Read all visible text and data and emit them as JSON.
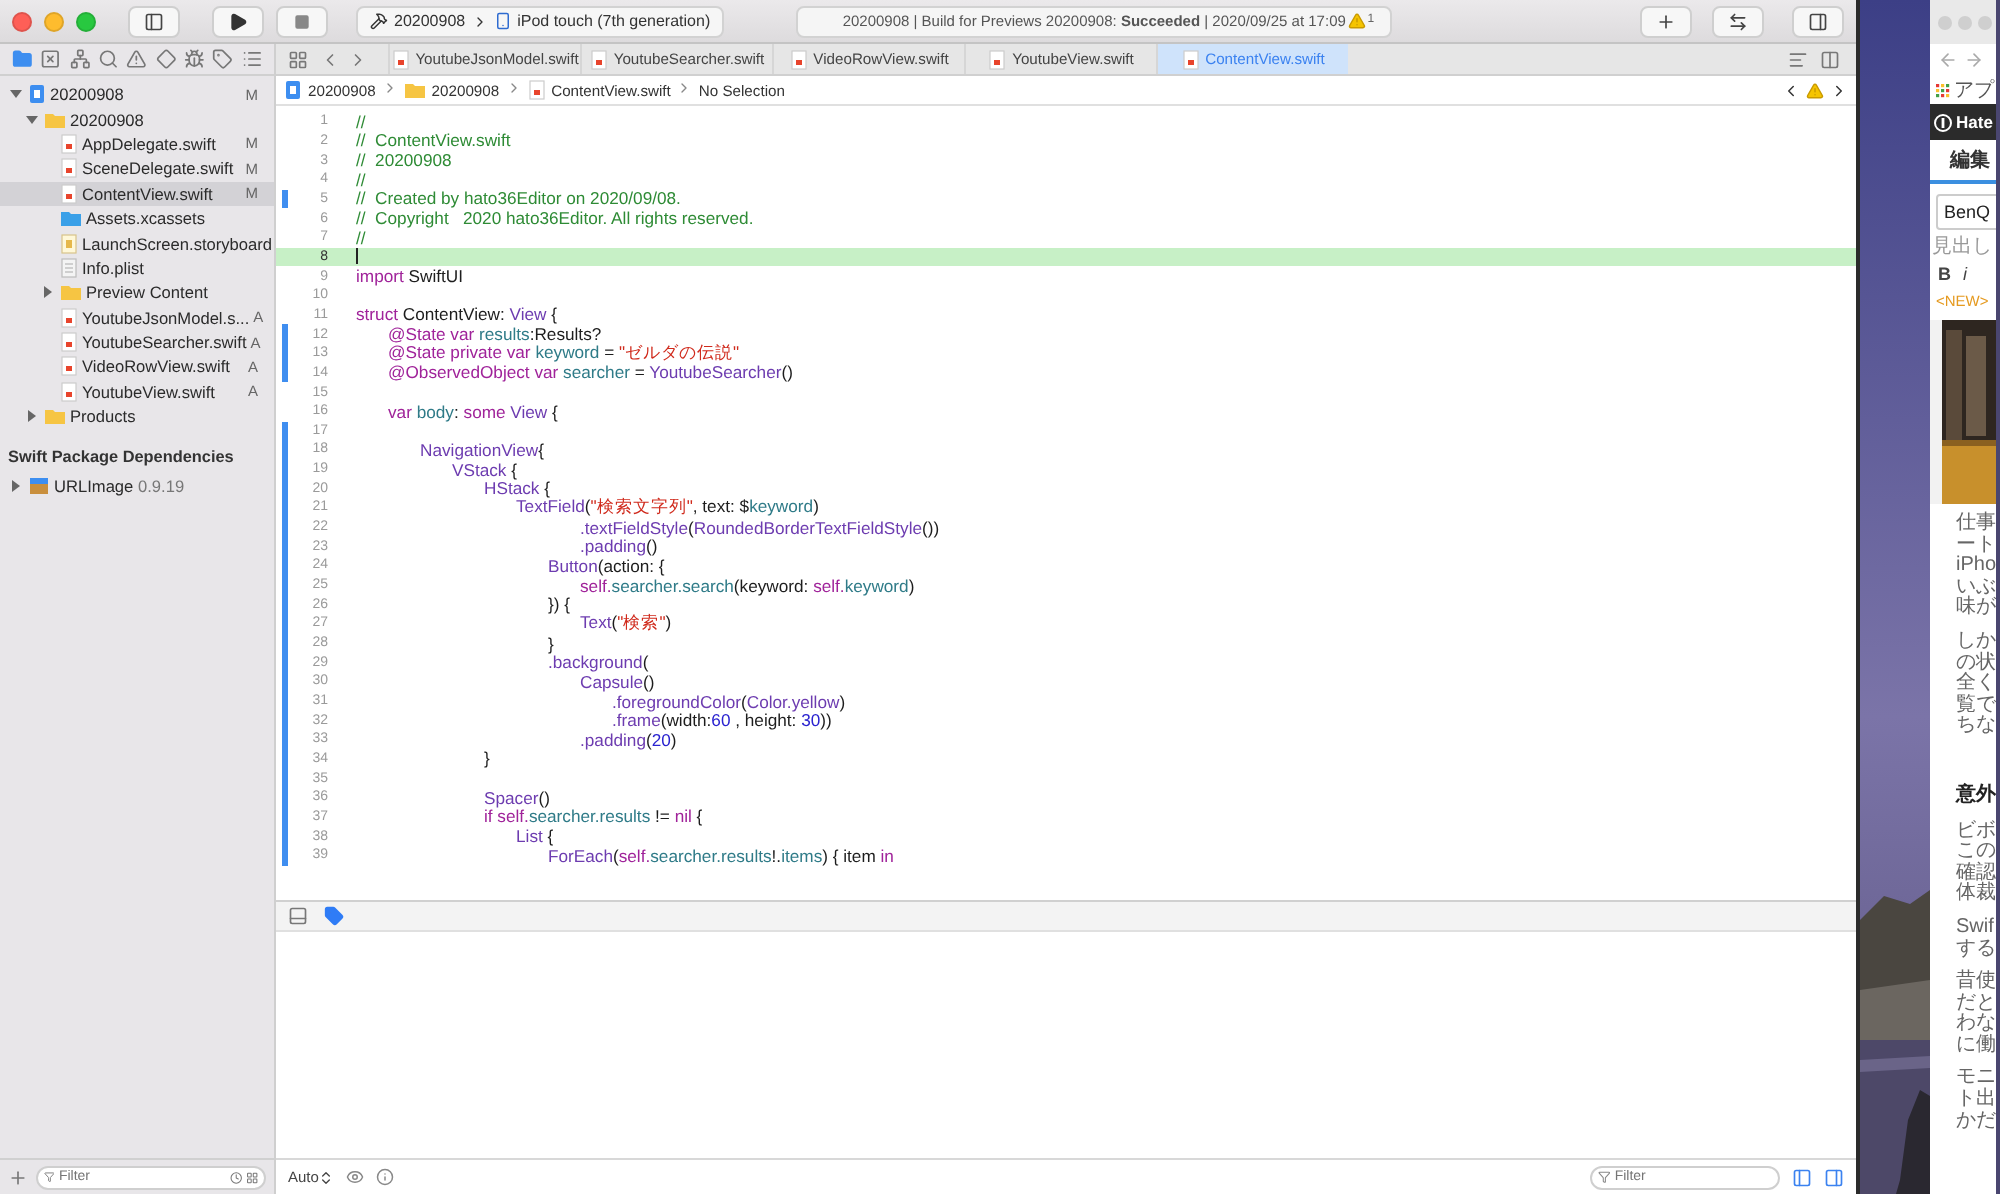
{
  "toolbar": {
    "scheme": {
      "project": "20200908",
      "device": "iPod touch (7th generation)"
    },
    "activity": {
      "text": "20200908 | Build for Previews 20200908: **Succeeded** | 2020/09/25 at 17:09",
      "warnings": "1"
    }
  },
  "navigator": {
    "tree": [
      {
        "name": "20200908",
        "kind": "project",
        "badge": "M",
        "expanded": true,
        "selected": false,
        "children": [
          {
            "name": "20200908",
            "kind": "folder",
            "expanded": true,
            "selected": false,
            "children": [
              {
                "name": "AppDelegate.swift",
                "kind": "swift",
                "badge": "M",
                "selected": false
              },
              {
                "name": "SceneDelegate.swift",
                "kind": "swift",
                "badge": "M",
                "selected": false
              },
              {
                "name": "ContentView.swift",
                "kind": "swift",
                "badge": "M",
                "selected": true
              },
              {
                "name": "Assets.xcassets",
                "kind": "assets",
                "selected": false
              },
              {
                "name": "LaunchScreen.storyboard",
                "kind": "storyboard",
                "selected": false
              },
              {
                "name": "Info.plist",
                "kind": "plist",
                "selected": false
              },
              {
                "name": "Preview Content",
                "kind": "folder",
                "expanded": false,
                "selected": false
              },
              {
                "name": "YoutubeJsonModel.s...",
                "kind": "swift",
                "badge": "A",
                "selected": false
              },
              {
                "name": "YoutubeSearcher.swift",
                "kind": "swift",
                "badge": "A",
                "selected": false
              },
              {
                "name": "VideoRowView.swift",
                "kind": "swift",
                "badge": "A",
                "selected": false
              },
              {
                "name": "YoutubeView.swift",
                "kind": "swift",
                "badge": "A",
                "selected": false
              }
            ]
          },
          {
            "name": "Products",
            "kind": "folder",
            "expanded": false,
            "selected": false
          }
        ]
      }
    ],
    "section": "Swift Package Dependencies",
    "packages": [
      {
        "name": "URLImage",
        "version": "0.9.19",
        "kind": "package",
        "expanded": false,
        "selected": false
      }
    ],
    "filter_placeholder": "Filter"
  },
  "tabs": [
    {
      "label": "YoutubeJsonModel.swift",
      "selected": false
    },
    {
      "label": "YoutubeSearcher.swift",
      "selected": false
    },
    {
      "label": "VideoRowView.swift",
      "selected": false
    },
    {
      "label": "YoutubeView.swift",
      "selected": false
    },
    {
      "label": "ContentView.swift",
      "selected": true
    }
  ],
  "breadcrumb": [
    {
      "text": "20200908",
      "kind": "project"
    },
    {
      "text": "20200908",
      "kind": "folder"
    },
    {
      "text": "ContentView.swift",
      "kind": "swift"
    },
    {
      "text": "No Selection",
      "kind": "none"
    }
  ],
  "code": {
    "lines": [
      {
        "n": "1",
        "changed": false,
        "current": false,
        "tokens": [
          {
            "kind": "comment",
            "text": "//"
          }
        ]
      },
      {
        "n": "2",
        "changed": false,
        "current": false,
        "tokens": [
          {
            "kind": "comment",
            "text": "//  ContentView.swift"
          }
        ]
      },
      {
        "n": "3",
        "changed": false,
        "current": false,
        "tokens": [
          {
            "kind": "comment",
            "text": "//  20200908"
          }
        ]
      },
      {
        "n": "4",
        "changed": false,
        "current": false,
        "tokens": [
          {
            "kind": "comment",
            "text": "//"
          }
        ]
      },
      {
        "n": "5",
        "changed": true,
        "current": false,
        "tokens": [
          {
            "kind": "comment",
            "text": "//  Created by hato36Editor on 2020/09/08."
          }
        ]
      },
      {
        "n": "6",
        "changed": false,
        "current": false,
        "tokens": [
          {
            "kind": "comment",
            "text": "//  Copyright   2020 hato36Editor. All rights reserved."
          }
        ]
      },
      {
        "n": "7",
        "changed": false,
        "current": false,
        "tokens": [
          {
            "kind": "comment",
            "text": "//"
          }
        ]
      },
      {
        "n": "8",
        "changed": false,
        "current": true
      },
      {
        "n": "9",
        "changed": false,
        "current": false,
        "tokens": [
          {
            "kind": "keyword",
            "text": "import"
          },
          {
            "kind": "plain",
            "text": " SwiftUI"
          }
        ]
      },
      {
        "n": "10",
        "changed": false,
        "current": false
      },
      {
        "n": "11",
        "changed": false,
        "current": false,
        "tokens": [
          {
            "kind": "keyword",
            "text": "struct"
          },
          {
            "kind": "plain",
            "text": " ContentView: "
          },
          {
            "kind": "type",
            "text": "View"
          },
          {
            "kind": "plain",
            "text": " {"
          }
        ]
      },
      {
        "n": "12",
        "changed": true,
        "current": false,
        "tokens": [
          {
            "kind": "keyword",
            "text": "\t@State var"
          },
          {
            "kind": "member",
            "text": " results"
          },
          {
            "kind": "plain",
            "text": ":Results?"
          }
        ]
      },
      {
        "n": "13",
        "changed": true,
        "current": false,
        "tokens": [
          {
            "kind": "keyword",
            "text": "\t@State private var"
          },
          {
            "kind": "member",
            "text": " keyword"
          },
          {
            "kind": "plain",
            "text": " = "
          },
          {
            "kind": "string",
            "text": "\"ゼルダの伝説\""
          }
        ]
      },
      {
        "n": "14",
        "changed": true,
        "current": false,
        "tokens": [
          {
            "kind": "keyword",
            "text": "\t@ObservedObject var"
          },
          {
            "kind": "member",
            "text": " searcher"
          },
          {
            "kind": "plain",
            "text": " = "
          },
          {
            "kind": "type",
            "text": "YoutubeSearcher"
          },
          {
            "kind": "plain",
            "text": "()"
          }
        ]
      },
      {
        "n": "15",
        "changed": false,
        "current": false
      },
      {
        "n": "16",
        "changed": false,
        "current": false,
        "tokens": [
          {
            "kind": "keyword",
            "text": "\tvar"
          },
          {
            "kind": "member",
            "text": " body"
          },
          {
            "kind": "plain",
            "text": ": "
          },
          {
            "kind": "keyword",
            "text": "some"
          },
          {
            "kind": "type",
            "text": " View"
          },
          {
            "kind": "plain",
            "text": " {"
          }
        ]
      },
      {
        "n": "17",
        "changed": true,
        "current": false
      },
      {
        "n": "18",
        "changed": true,
        "current": false,
        "tokens": [
          {
            "kind": "type",
            "text": "\t\tNavigationView"
          },
          {
            "kind": "plain",
            "text": "{"
          }
        ]
      },
      {
        "n": "19",
        "changed": true,
        "current": false,
        "tokens": [
          {
            "kind": "type",
            "text": "\t\t\tVStack"
          },
          {
            "kind": "plain",
            "text": " {"
          }
        ]
      },
      {
        "n": "20",
        "changed": true,
        "current": false,
        "tokens": [
          {
            "kind": "type",
            "text": "\t\t\t\tHStack"
          },
          {
            "kind": "plain",
            "text": " {"
          }
        ]
      },
      {
        "n": "21",
        "changed": true,
        "current": false,
        "tokens": [
          {
            "kind": "type",
            "text": "\t\t\t\t\tTextField"
          },
          {
            "kind": "plain",
            "text": "("
          },
          {
            "kind": "string",
            "text": "\"検索文字列\""
          },
          {
            "kind": "plain",
            "text": ", text: $"
          },
          {
            "kind": "member",
            "text": "keyword"
          },
          {
            "kind": "plain",
            "text": ")"
          }
        ]
      },
      {
        "n": "22",
        "changed": true,
        "current": false,
        "tokens": [
          {
            "kind": "type",
            "text": "\t\t\t\t\t\t\t.textFieldStyle"
          },
          {
            "kind": "plain",
            "text": "("
          },
          {
            "kind": "type",
            "text": "RoundedBorderTextFieldStyle"
          },
          {
            "kind": "plain",
            "text": "())"
          }
        ]
      },
      {
        "n": "23",
        "changed": true,
        "current": false,
        "tokens": [
          {
            "kind": "type",
            "text": "\t\t\t\t\t\t\t.padding"
          },
          {
            "kind": "plain",
            "text": "()"
          }
        ]
      },
      {
        "n": "24",
        "changed": true,
        "current": false,
        "tokens": [
          {
            "kind": "type",
            "text": "\t\t\t\t\t\tButton"
          },
          {
            "kind": "plain",
            "text": "(action: {"
          }
        ]
      },
      {
        "n": "25",
        "changed": true,
        "current": false,
        "tokens": [
          {
            "kind": "keyword",
            "text": "\t\t\t\t\t\t\tself."
          },
          {
            "kind": "member",
            "text": "searcher.search"
          },
          {
            "kind": "plain",
            "text": "(keyword: "
          },
          {
            "kind": "keyword",
            "text": "self."
          },
          {
            "kind": "member",
            "text": "keyword"
          },
          {
            "kind": "plain",
            "text": ")"
          }
        ]
      },
      {
        "n": "26",
        "changed": true,
        "current": false,
        "tokens": [
          {
            "kind": "plain",
            "text": "\t\t\t\t\t\t}) {"
          }
        ]
      },
      {
        "n": "27",
        "changed": true,
        "current": false,
        "tokens": [
          {
            "kind": "type",
            "text": "\t\t\t\t\t\t\tText"
          },
          {
            "kind": "plain",
            "text": "("
          },
          {
            "kind": "string",
            "text": "\"検索\""
          },
          {
            "kind": "plain",
            "text": ")"
          }
        ]
      },
      {
        "n": "28",
        "changed": true,
        "current": false,
        "tokens": [
          {
            "kind": "plain",
            "text": "\t\t\t\t\t\t}"
          }
        ]
      },
      {
        "n": "29",
        "changed": true,
        "current": false,
        "tokens": [
          {
            "kind": "type",
            "text": "\t\t\t\t\t\t.background"
          },
          {
            "kind": "plain",
            "text": "("
          }
        ]
      },
      {
        "n": "30",
        "changed": true,
        "current": false,
        "tokens": [
          {
            "kind": "type",
            "text": "\t\t\t\t\t\t\tCapsule"
          },
          {
            "kind": "plain",
            "text": "()"
          }
        ]
      },
      {
        "n": "31",
        "changed": true,
        "current": false,
        "tokens": [
          {
            "kind": "type",
            "text": "\t\t\t\t\t\t\t\t.foregroundColor"
          },
          {
            "kind": "plain",
            "text": "("
          },
          {
            "kind": "type",
            "text": "Color.yellow"
          },
          {
            "kind": "plain",
            "text": ")"
          }
        ]
      },
      {
        "n": "32",
        "changed": true,
        "current": false,
        "tokens": [
          {
            "kind": "type",
            "text": "\t\t\t\t\t\t\t\t.frame"
          },
          {
            "kind": "plain",
            "text": "(width:"
          },
          {
            "kind": "number",
            "text": "60"
          },
          {
            "kind": "plain",
            "text": " , height: "
          },
          {
            "kind": "number",
            "text": "30"
          },
          {
            "kind": "plain",
            "text": "))"
          }
        ]
      },
      {
        "n": "33",
        "changed": true,
        "current": false,
        "tokens": [
          {
            "kind": "type",
            "text": "\t\t\t\t\t\t\t.padding"
          },
          {
            "kind": "plain",
            "text": "("
          },
          {
            "kind": "number",
            "text": "20"
          },
          {
            "kind": "plain",
            "text": ")"
          }
        ]
      },
      {
        "n": "34",
        "changed": true,
        "current": false,
        "tokens": [
          {
            "kind": "plain",
            "text": "\t\t\t\t}"
          }
        ]
      },
      {
        "n": "35",
        "changed": true,
        "current": false
      },
      {
        "n": "36",
        "changed": true,
        "current": false,
        "tokens": [
          {
            "kind": "type",
            "text": "\t\t\t\tSpacer"
          },
          {
            "kind": "plain",
            "text": "()"
          }
        ]
      },
      {
        "n": "37",
        "changed": true,
        "current": false,
        "tokens": [
          {
            "kind": "keyword",
            "text": "\t\t\t\tif self."
          },
          {
            "kind": "member",
            "text": "searcher.results"
          },
          {
            "kind": "plain",
            "text": " != "
          },
          {
            "kind": "keyword",
            "text": "nil"
          },
          {
            "kind": "plain",
            "text": " {"
          }
        ]
      },
      {
        "n": "38",
        "changed": true,
        "current": false,
        "tokens": [
          {
            "kind": "type",
            "text": "\t\t\t\t\tList"
          },
          {
            "kind": "plain",
            "text": " {"
          }
        ]
      },
      {
        "n": "39",
        "changed": true,
        "current": false,
        "tokens": [
          {
            "kind": "type",
            "text": "\t\t\t\t\t\tForEach"
          },
          {
            "kind": "plain",
            "text": "("
          },
          {
            "kind": "keyword",
            "text": "self."
          },
          {
            "kind": "member",
            "text": "searcher.results"
          },
          {
            "kind": "plain",
            "text": "!."
          },
          {
            "kind": "member",
            "text": "items"
          },
          {
            "kind": "plain",
            "text": ") { item "
          },
          {
            "kind": "keyword",
            "text": "in"
          }
        ]
      }
    ]
  },
  "console": {
    "mode": "Auto",
    "filter_placeholder": "Filter"
  },
  "browser": {
    "bookmarks": "アプ",
    "brand": "Hate",
    "tabs": [
      {
        "label": "編集",
        "selected": true
      }
    ],
    "title_value": "BenQ",
    "heading_select": "見出し",
    "format_buttons": [
      "B",
      "i"
    ],
    "new_label": "<NEW>",
    "blocks": [
      {
        "kind": "para",
        "lines": [
          "仕事",
          "ート",
          "iPho",
          "いぶ",
          "味が"
        ]
      },
      {
        "kind": "para",
        "lines": [
          "しか",
          "の状",
          "全く",
          "覧で",
          "ちな"
        ]
      },
      {
        "kind": "heading",
        "lines": [
          "意外"
        ]
      },
      {
        "kind": "para",
        "lines": [
          "ビボ",
          "この",
          "確認",
          "体裁"
        ]
      },
      {
        "kind": "para",
        "lines": [
          "Swif",
          "する"
        ]
      },
      {
        "kind": "para",
        "lines": [
          "昔使",
          "だと",
          "わな",
          "に働"
        ]
      },
      {
        "kind": "para",
        "lines": [
          "モニ",
          "ト出",
          "かだ"
        ]
      }
    ]
  }
}
